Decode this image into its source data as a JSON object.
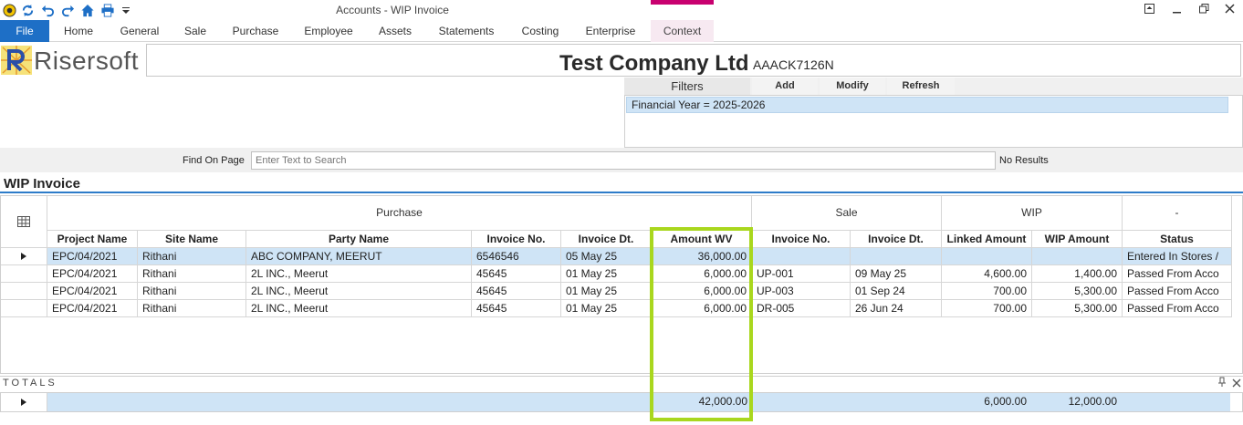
{
  "window": {
    "title": "Accounts - WIP Invoice"
  },
  "ribbon": {
    "tabs": [
      "File",
      "Home",
      "General",
      "Sale",
      "Purchase",
      "Employee",
      "Assets",
      "Statements",
      "Costing",
      "Enterprise",
      "Context"
    ]
  },
  "brand": {
    "logo_text": "Risersoft",
    "company_name": "Test Company Ltd",
    "company_code": "AAACK7126N"
  },
  "filters": {
    "title": "Filters",
    "add_label": "Add",
    "modify_label": "Modify",
    "refresh_label": "Refresh",
    "items": [
      "Financial Year = 2025-2026"
    ]
  },
  "find": {
    "label": "Find On Page",
    "placeholder": "Enter Text to Search",
    "result": "No Results"
  },
  "section": {
    "title": "WIP Invoice"
  },
  "grid": {
    "bands": {
      "purchase": "Purchase",
      "sale": "Sale",
      "wip": "WIP",
      "other": "-"
    },
    "columns": [
      "Project Name",
      "Site Name",
      "Party Name",
      "Invoice No.",
      "Invoice Dt.",
      "Amount WV",
      "Invoice No.",
      "Invoice Dt.",
      "Linked Amount",
      "WIP Amount",
      "Status"
    ],
    "rows": [
      [
        "EPC/04/2021",
        "Rithani",
        "ABC COMPANY, MEERUT",
        "6546546",
        "05 May 25",
        "36,000.00",
        "",
        "",
        "",
        "",
        "Entered In Stores /"
      ],
      [
        "EPC/04/2021",
        "Rithani",
        "2L INC., Meerut",
        "45645",
        "01 May 25",
        "6,000.00",
        "UP-001",
        "09 May 25",
        "4,600.00",
        "1,400.00",
        "Passed From Acco"
      ],
      [
        "EPC/04/2021",
        "Rithani",
        "2L INC., Meerut",
        "45645",
        "01 May 25",
        "6,000.00",
        "UP-003",
        "01 Sep 24",
        "700.00",
        "5,300.00",
        "Passed From Acco"
      ],
      [
        "EPC/04/2021",
        "Rithani",
        "2L INC., Meerut",
        "45645",
        "01 May 25",
        "6,000.00",
        "DR-005",
        "26 Jun 24",
        "700.00",
        "5,300.00",
        "Passed From Acco"
      ]
    ],
    "selected_row": 0
  },
  "totals": {
    "label": "TOTALS",
    "amount_wv": "42,000.00",
    "linked_amount": "6,000.00",
    "wip_amount": "12,000.00"
  },
  "colors": {
    "accent": "#1e6fc6",
    "context": "#c8006f",
    "selection": "#cfe4f6",
    "highlight": "#a9d71e"
  }
}
